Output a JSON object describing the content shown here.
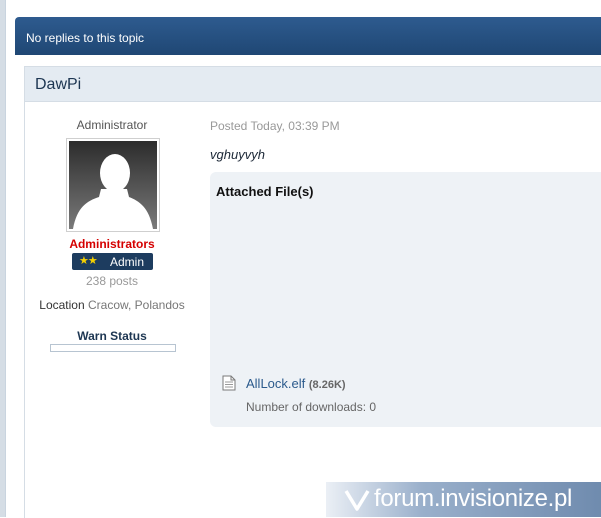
{
  "topic_bar": {
    "label": "No replies to this topic"
  },
  "post": {
    "author": {
      "name": "DawPi",
      "title": "Administrator",
      "group": "Administrators",
      "rank_stars": "★★",
      "rank_label": "Admin",
      "posts": "238 posts",
      "location_label": "Location",
      "location_value": "Cracow, Polandos",
      "warn_status": "Warn Status"
    },
    "posted": "Posted Today, 03:39 PM",
    "body": "vghuyvyh",
    "attachments": {
      "title": "Attached File(s)",
      "file": {
        "name": "AllLock.elf",
        "size": "(8.26K)",
        "downloads": "Number of downloads: 0"
      }
    }
  },
  "watermark": {
    "text": "forum.invisionize.pl"
  },
  "colors": {
    "bar": "#1f4774",
    "header": "#e4ebf2",
    "group": "#d50000",
    "link": "#2b5a8c"
  }
}
